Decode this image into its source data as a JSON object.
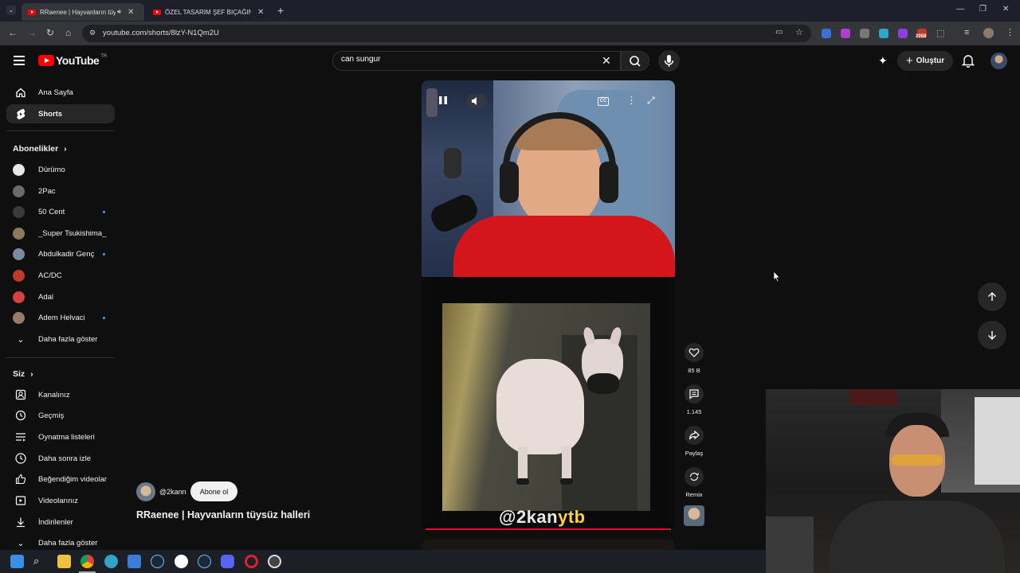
{
  "browser": {
    "tabs": [
      {
        "title": "RRaenee | Hayvanların tüysüz",
        "active": true
      },
      {
        "title": "ÖZEL TASARIM ŞEF BIÇAĞINI İN",
        "active": false
      }
    ],
    "url": "youtube.com/shorts/8lzY-N1Qm2U",
    "extension_badge": "2058"
  },
  "header": {
    "logo_text": "YouTube",
    "country_code": "TR",
    "search_value": "can sungur",
    "create_label": "Oluştur"
  },
  "sidebar": {
    "main": [
      {
        "label": "Ana Sayfa",
        "icon": "home-icon"
      },
      {
        "label": "Shorts",
        "icon": "shorts-icon",
        "active": true
      }
    ],
    "subscriptions_title": "Abonelikler",
    "subscriptions": [
      {
        "label": "Dürümo",
        "color": "#e0e0e0",
        "dot": false
      },
      {
        "label": "2Pac",
        "color": "#6b6b6b",
        "dot": false
      },
      {
        "label": "50 Cent",
        "color": "#3a3a3a",
        "dot": true
      },
      {
        "label": "_Super Tsukishima_",
        "color": "#8a7a5a",
        "dot": false
      },
      {
        "label": "Abdulkadir Genç",
        "color": "#7a8aa0",
        "dot": true
      },
      {
        "label": "AC/DC",
        "color": "#c0392b",
        "dot": false
      },
      {
        "label": "Adal",
        "color": "#d64040",
        "dot": false
      },
      {
        "label": "Adem Helvaci",
        "color": "#9a7a6a",
        "dot": true
      }
    ],
    "show_more": "Daha fazla göster",
    "you_title": "Siz",
    "you_items": [
      {
        "label": "Kanalınız",
        "icon": "channel-icon"
      },
      {
        "label": "Geçmiş",
        "icon": "history-icon"
      },
      {
        "label": "Oynatma listeleri",
        "icon": "playlists-icon"
      },
      {
        "label": "Daha sonra izle",
        "icon": "watch-later-icon"
      },
      {
        "label": "Beğendiğim videolar",
        "icon": "like-icon"
      },
      {
        "label": "Videolarınız",
        "icon": "your-videos-icon"
      },
      {
        "label": "İndirilenler",
        "icon": "download-icon"
      }
    ],
    "you_show_more": "Daha fazla göster"
  },
  "short": {
    "channel_handle": "@2kann",
    "subscribe_label": "Abone ol",
    "title": "RRaenee | Hayvanların tüysüz halleri",
    "watermark_a": "@2kan",
    "watermark_b": "ytb",
    "progress": 0.99,
    "likes": "85 B",
    "comments": "1.145",
    "share_label": "Paylaş",
    "remix_label": "Remix"
  },
  "colors": {
    "accent_red": "#ff0000",
    "progress_red": "#ff0033",
    "bg": "#0f0f0f"
  }
}
